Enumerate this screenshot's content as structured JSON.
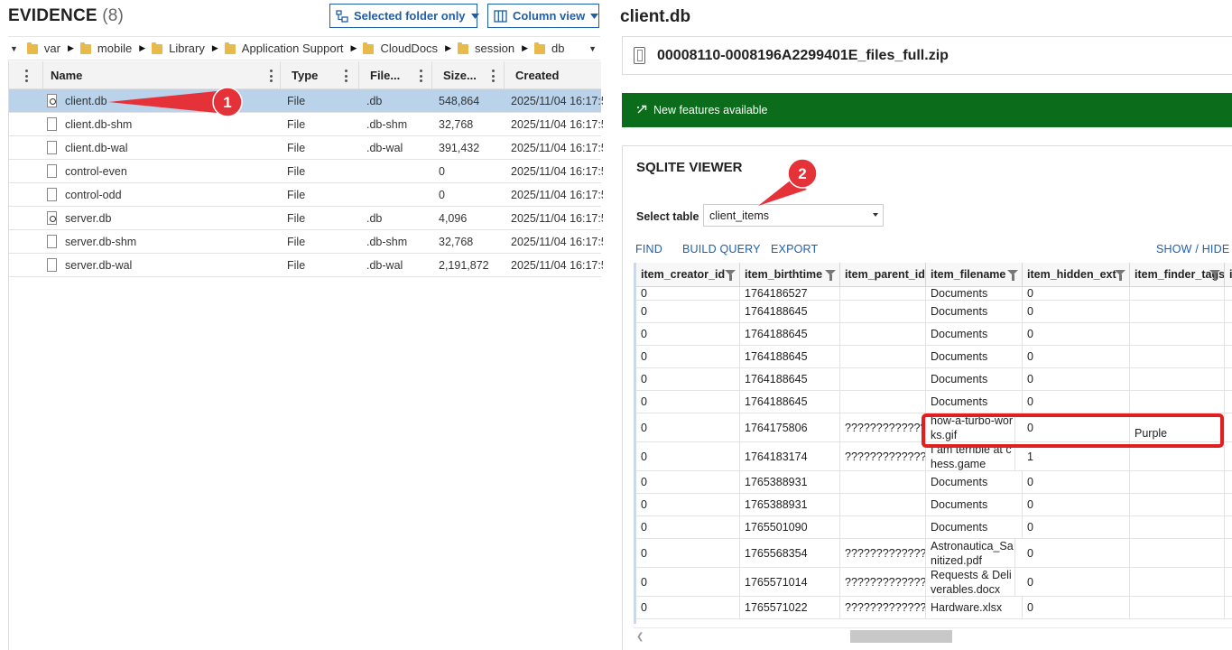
{
  "left": {
    "title": "EVIDENCE",
    "count": "(8)",
    "filter_button": "Selected folder only",
    "view_button": "Column view",
    "breadcrumb": [
      "var",
      "mobile",
      "Library",
      "Application Support",
      "CloudDocs",
      "session",
      "db"
    ],
    "columns": [
      "Name",
      "Type",
      "File...",
      "Size...",
      "Created"
    ],
    "files": [
      {
        "name": "client.db",
        "type": "File",
        "ext": ".db",
        "size": "548,864",
        "created": "2025/11/04 16:17:5",
        "icon": "database-file-icon"
      },
      {
        "name": "client.db-shm",
        "type": "File",
        "ext": ".db-shm",
        "size": "32,768",
        "created": "2025/11/04 16:17:5",
        "icon": "file-icon"
      },
      {
        "name": "client.db-wal",
        "type": "File",
        "ext": ".db-wal",
        "size": "391,432",
        "created": "2025/11/04 16:17:5",
        "icon": "file-icon"
      },
      {
        "name": "control-even",
        "type": "File",
        "ext": "",
        "size": "0",
        "created": "2025/11/04 16:17:5",
        "icon": "file-icon"
      },
      {
        "name": "control-odd",
        "type": "File",
        "ext": "",
        "size": "0",
        "created": "2025/11/04 16:17:5",
        "icon": "file-icon"
      },
      {
        "name": "server.db",
        "type": "File",
        "ext": ".db",
        "size": "4,096",
        "created": "2025/11/04 16:17:5",
        "icon": "database-file-icon"
      },
      {
        "name": "server.db-shm",
        "type": "File",
        "ext": ".db-shm",
        "size": "32,768",
        "created": "2025/11/04 16:17:5",
        "icon": "file-icon"
      },
      {
        "name": "server.db-wal",
        "type": "File",
        "ext": ".db-wal",
        "size": "2,191,872",
        "created": "2025/11/04 16:17:5",
        "icon": "file-icon"
      }
    ],
    "selected_index": 0
  },
  "right": {
    "title": "client.db",
    "file_name": "00008110-0008196A2299401E_files_full.zip",
    "banner": "New features available",
    "sqlite_title": "SQLITE VIEWER",
    "select_label": "Select table",
    "selected_table": "client_items",
    "links": {
      "find": "FIND",
      "build_query": "BUILD QUERY",
      "export": "EXPORT",
      "show_hide": "SHOW / HIDE CO"
    },
    "grid_columns": [
      "item_creator_id",
      "item_birthtime",
      "item_parent_id",
      "item_filename",
      "item_hidden_ext",
      "item_finder_tags",
      "i"
    ],
    "rows": [
      [
        "0",
        "1764186527",
        "",
        "Documents",
        "0",
        ""
      ],
      [
        "0",
        "1764188645",
        "",
        "Documents",
        "0",
        ""
      ],
      [
        "0",
        "1764188645",
        "",
        "Documents",
        "0",
        ""
      ],
      [
        "0",
        "1764188645",
        "",
        "Documents",
        "0",
        ""
      ],
      [
        "0",
        "1764188645",
        "",
        "Documents",
        "0",
        ""
      ],
      [
        "0",
        "1764188645",
        "",
        "Documents",
        "0",
        ""
      ],
      [
        "0",
        "1764175806",
        "????????????????",
        "how-a-turbo-works.gif",
        "0",
        "Purple"
      ],
      [
        "0",
        "1764183174",
        "????????????????",
        "I am terrible at chess.game",
        "1",
        ""
      ],
      [
        "0",
        "1765388931",
        "",
        "Documents",
        "0",
        ""
      ],
      [
        "0",
        "1765388931",
        "",
        "Documents",
        "0",
        ""
      ],
      [
        "0",
        "1765501090",
        "",
        "Documents",
        "0",
        ""
      ],
      [
        "0",
        "1765568354",
        "????????????????",
        "Astronautica_Sanitized.pdf",
        "0",
        ""
      ],
      [
        "0",
        "1765571014",
        "????????????????",
        "Requests & Deliverables.docx",
        "0",
        ""
      ],
      [
        "0",
        "1765571022",
        "????????????????",
        "Hardware.xlsx",
        "0",
        ""
      ]
    ]
  },
  "callouts": [
    "1",
    "2"
  ],
  "colors": {
    "accent": "#1f5fa8",
    "banner": "#0b6d1c",
    "selected_row": "#bad3ea",
    "callout": "#e53238"
  }
}
